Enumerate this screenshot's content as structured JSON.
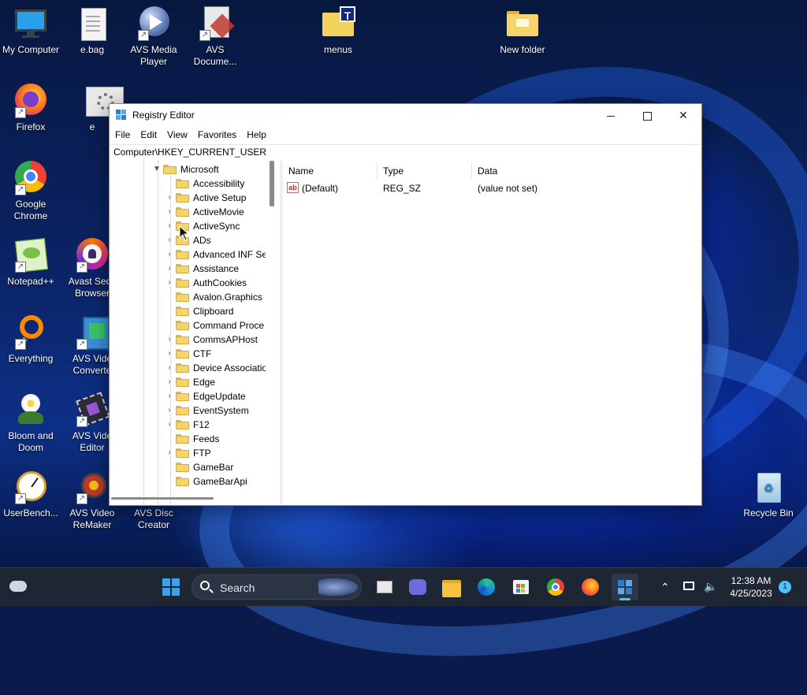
{
  "desktop": {
    "icons": [
      {
        "label": "My Computer"
      },
      {
        "label": "e.bag"
      },
      {
        "label": "AVS Media Player"
      },
      {
        "label": "AVS Docume..."
      },
      {
        "label": "menus"
      },
      {
        "label": "New folder"
      },
      {
        "label": "Firefox"
      },
      {
        "label": "e"
      },
      {
        "label": "Google Chrome"
      },
      {
        "label": "Notepad++"
      },
      {
        "label": "Avast Secu Browser"
      },
      {
        "label": "Everything"
      },
      {
        "label": "AVS Vide Converte"
      },
      {
        "label": "Bloom and Doom"
      },
      {
        "label": "AVS Vide Editor"
      },
      {
        "label": "UserBench..."
      },
      {
        "label": "AVS Video ReMaker"
      },
      {
        "label": "AVS Disc Creator"
      },
      {
        "label": "Recycle Bin"
      }
    ]
  },
  "window": {
    "title": "Registry Editor",
    "menu": [
      "File",
      "Edit",
      "View",
      "Favorites",
      "Help"
    ],
    "address": "Computer\\HKEY_CURRENT_USER",
    "tree": {
      "parent": "Microsoft",
      "children": [
        {
          "label": "Accessibility",
          "expandable": false
        },
        {
          "label": "Active Setup",
          "expandable": true
        },
        {
          "label": "ActiveMovie",
          "expandable": true
        },
        {
          "label": "ActiveSync",
          "expandable": true
        },
        {
          "label": "ADs",
          "expandable": true
        },
        {
          "label": "Advanced INF Set",
          "expandable": true
        },
        {
          "label": "Assistance",
          "expandable": true
        },
        {
          "label": "AuthCookies",
          "expandable": true
        },
        {
          "label": "Avalon.Graphics",
          "expandable": false
        },
        {
          "label": "Clipboard",
          "expandable": false
        },
        {
          "label": "Command Proce",
          "expandable": false
        },
        {
          "label": "CommsAPHost",
          "expandable": true
        },
        {
          "label": "CTF",
          "expandable": true
        },
        {
          "label": "Device Associatio",
          "expandable": true
        },
        {
          "label": "Edge",
          "expandable": true
        },
        {
          "label": "EdgeUpdate",
          "expandable": true
        },
        {
          "label": "EventSystem",
          "expandable": true
        },
        {
          "label": "F12",
          "expandable": true
        },
        {
          "label": "Feeds",
          "expandable": false
        },
        {
          "label": "FTP",
          "expandable": true
        },
        {
          "label": "GameBar",
          "expandable": false
        },
        {
          "label": "GameBarApi",
          "expandable": false
        }
      ]
    },
    "list": {
      "columns": [
        "Name",
        "Type",
        "Data"
      ],
      "rows": [
        {
          "name": "(Default)",
          "type": "REG_SZ",
          "data": "(value not set)",
          "icon": "ab-icon"
        }
      ]
    }
  },
  "taskbar": {
    "search_label": "Search",
    "time": "12:38 AM",
    "date": "4/25/2023",
    "notification_count": "1"
  },
  "colors": {
    "accent": "#1a5fd0",
    "taskbar": "#1e2533"
  }
}
